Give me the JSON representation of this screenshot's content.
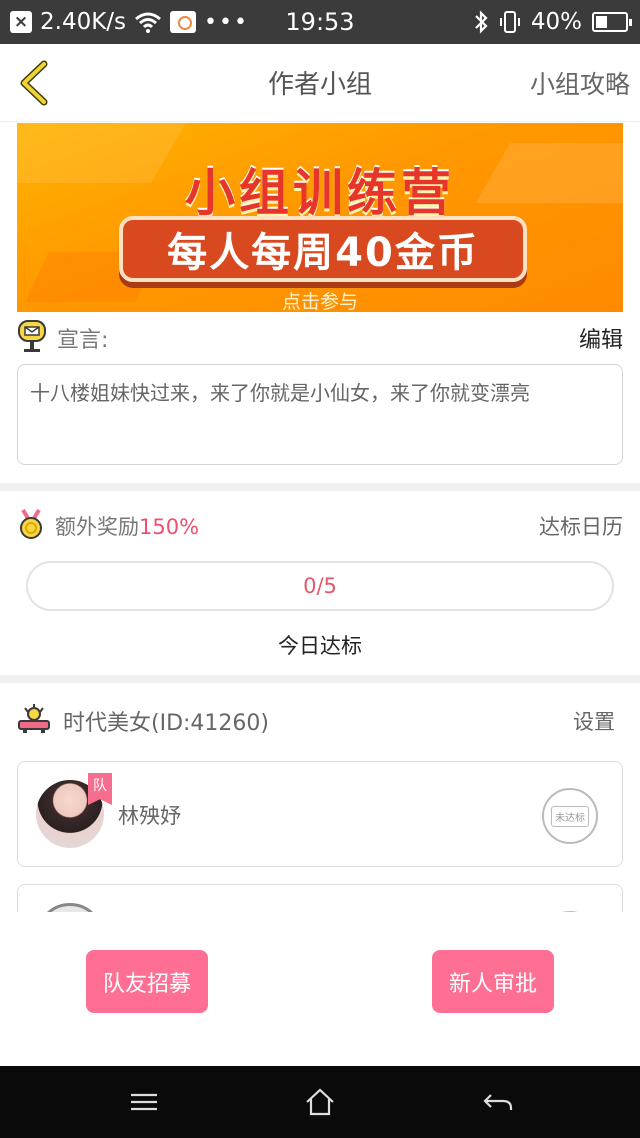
{
  "status_bar": {
    "speed": "2.40K/s",
    "time": "19:53",
    "battery": "40%",
    "battery_fraction": 0.4,
    "icons": [
      "close-notification-icon",
      "wifi-icon",
      "gallery-icon",
      "more-dots-icon",
      "bluetooth-icon",
      "vibrate-icon",
      "battery-icon"
    ]
  },
  "header": {
    "title": "作者小组",
    "guide_label": "小组攻略",
    "back_icon": "chevron-left-icon"
  },
  "banner": {
    "headline": "小组训练营",
    "pill_text": "每人每周40金币",
    "sub_text": "点击参与"
  },
  "declaration": {
    "label": "宣言:",
    "edit_label": "编辑",
    "text": "十八楼姐妹快过来，来了你就是小仙女，来了你就变漂亮"
  },
  "bonus": {
    "label": "额外奖励",
    "percent": "150%",
    "calendar_label": "达标日历",
    "progress_text": "0/5",
    "progress_fraction": 0,
    "today_label": "今日达标"
  },
  "team": {
    "name": "时代美女(ID:41260)",
    "settings_label": "设置",
    "members": [
      {
        "name": "林殃妤",
        "captain_badge": "队",
        "status_stamp": "未达标"
      }
    ]
  },
  "actions": {
    "recruit_label": "队友招募",
    "approve_label": "新人审批"
  },
  "colors": {
    "accent_pink": "#ff6f94",
    "percent_red": "#f0506e",
    "banner_orange": "#ff9800"
  }
}
